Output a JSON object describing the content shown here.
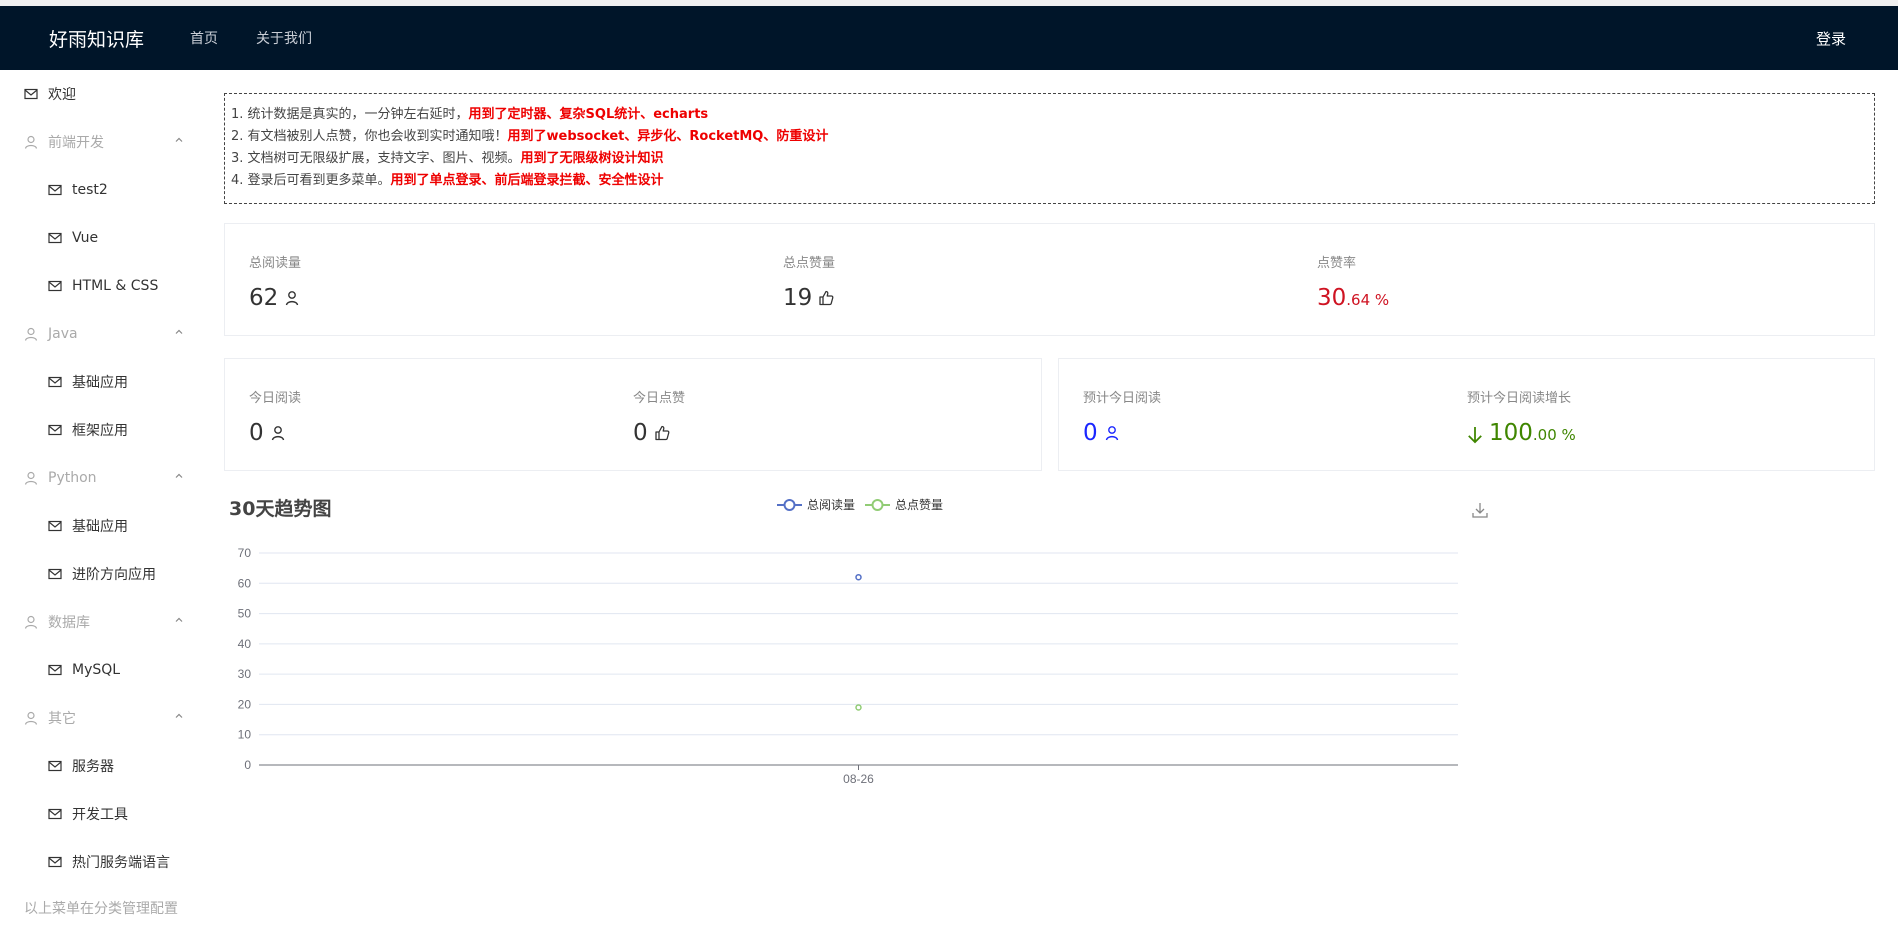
{
  "header": {
    "logo": "好雨知识库",
    "nav": [
      "首页",
      "关于我们"
    ],
    "login": "登录"
  },
  "sidebar": {
    "welcome": "欢迎",
    "groups": [
      {
        "label": "前端开发",
        "items": [
          "test2",
          "Vue",
          "HTML & CSS"
        ]
      },
      {
        "label": "Java",
        "items": [
          "基础应用",
          "框架应用"
        ]
      },
      {
        "label": "Python",
        "items": [
          "基础应用",
          "进阶方向应用"
        ]
      },
      {
        "label": "数据库",
        "items": [
          "MySQL"
        ]
      },
      {
        "label": "其它",
        "items": [
          "服务器",
          "开发工具",
          "热门服务端语言"
        ]
      }
    ],
    "footer": "以上菜单在分类管理配置"
  },
  "notice": {
    "lines": [
      {
        "text": "1. 统计数据是真实的，一分钟左右延时，",
        "highlight": "用到了定时器、复杂SQL统计、echarts"
      },
      {
        "text": "2. 有文档被别人点赞，你也会收到实时通知哦！",
        "highlight": "用到了websocket、异步化、RocketMQ、防重设计"
      },
      {
        "text": "3. 文档树可无限级扩展，支持文字、图片、视频。",
        "highlight": "用到了无限级树设计知识"
      },
      {
        "text": "4. 登录后可看到更多菜单。",
        "highlight": "用到了单点登录、前后端登录拦截、安全性设计"
      }
    ]
  },
  "stats_total": {
    "view_label": "总阅读量",
    "view_value": "62",
    "vote_label": "总点赞量",
    "vote_value": "19",
    "rate_label": "点赞率",
    "rate_int": "30",
    "rate_dec": ".64 %"
  },
  "stats_today": {
    "view_label": "今日阅读",
    "view_value": "0",
    "vote_label": "今日点赞",
    "vote_value": "0"
  },
  "stats_forecast": {
    "view_label": "预计今日阅读",
    "view_value": "0",
    "growth_label": "预计今日阅读增长",
    "growth_int": "100",
    "growth_dec": ".00 %"
  },
  "colors": {
    "header_bg": "#001529",
    "highlight_red": "#e00000",
    "rate_red": "#cf1322",
    "forecast_blue": "#1a26ff",
    "growth_green": "#3f8600",
    "series_view": "#5470c6",
    "series_vote": "#91cc75"
  },
  "icons": {
    "menu_item": "mail-icon",
    "menu_group": "user-icon",
    "view": "user-icon",
    "vote": "like-icon",
    "growth": "arrow-down-icon",
    "download": "download-icon"
  },
  "chart_data": {
    "type": "line",
    "title": "30天趋势图",
    "categories": [
      "08-26"
    ],
    "series": [
      {
        "name": "总阅读量",
        "values": [
          62
        ]
      },
      {
        "name": "总点赞量",
        "values": [
          19
        ]
      }
    ],
    "ylim": [
      0,
      70
    ],
    "yticks": [
      0,
      10,
      20,
      30,
      40,
      50,
      60,
      70
    ],
    "grid": true,
    "legend": "top-center"
  }
}
